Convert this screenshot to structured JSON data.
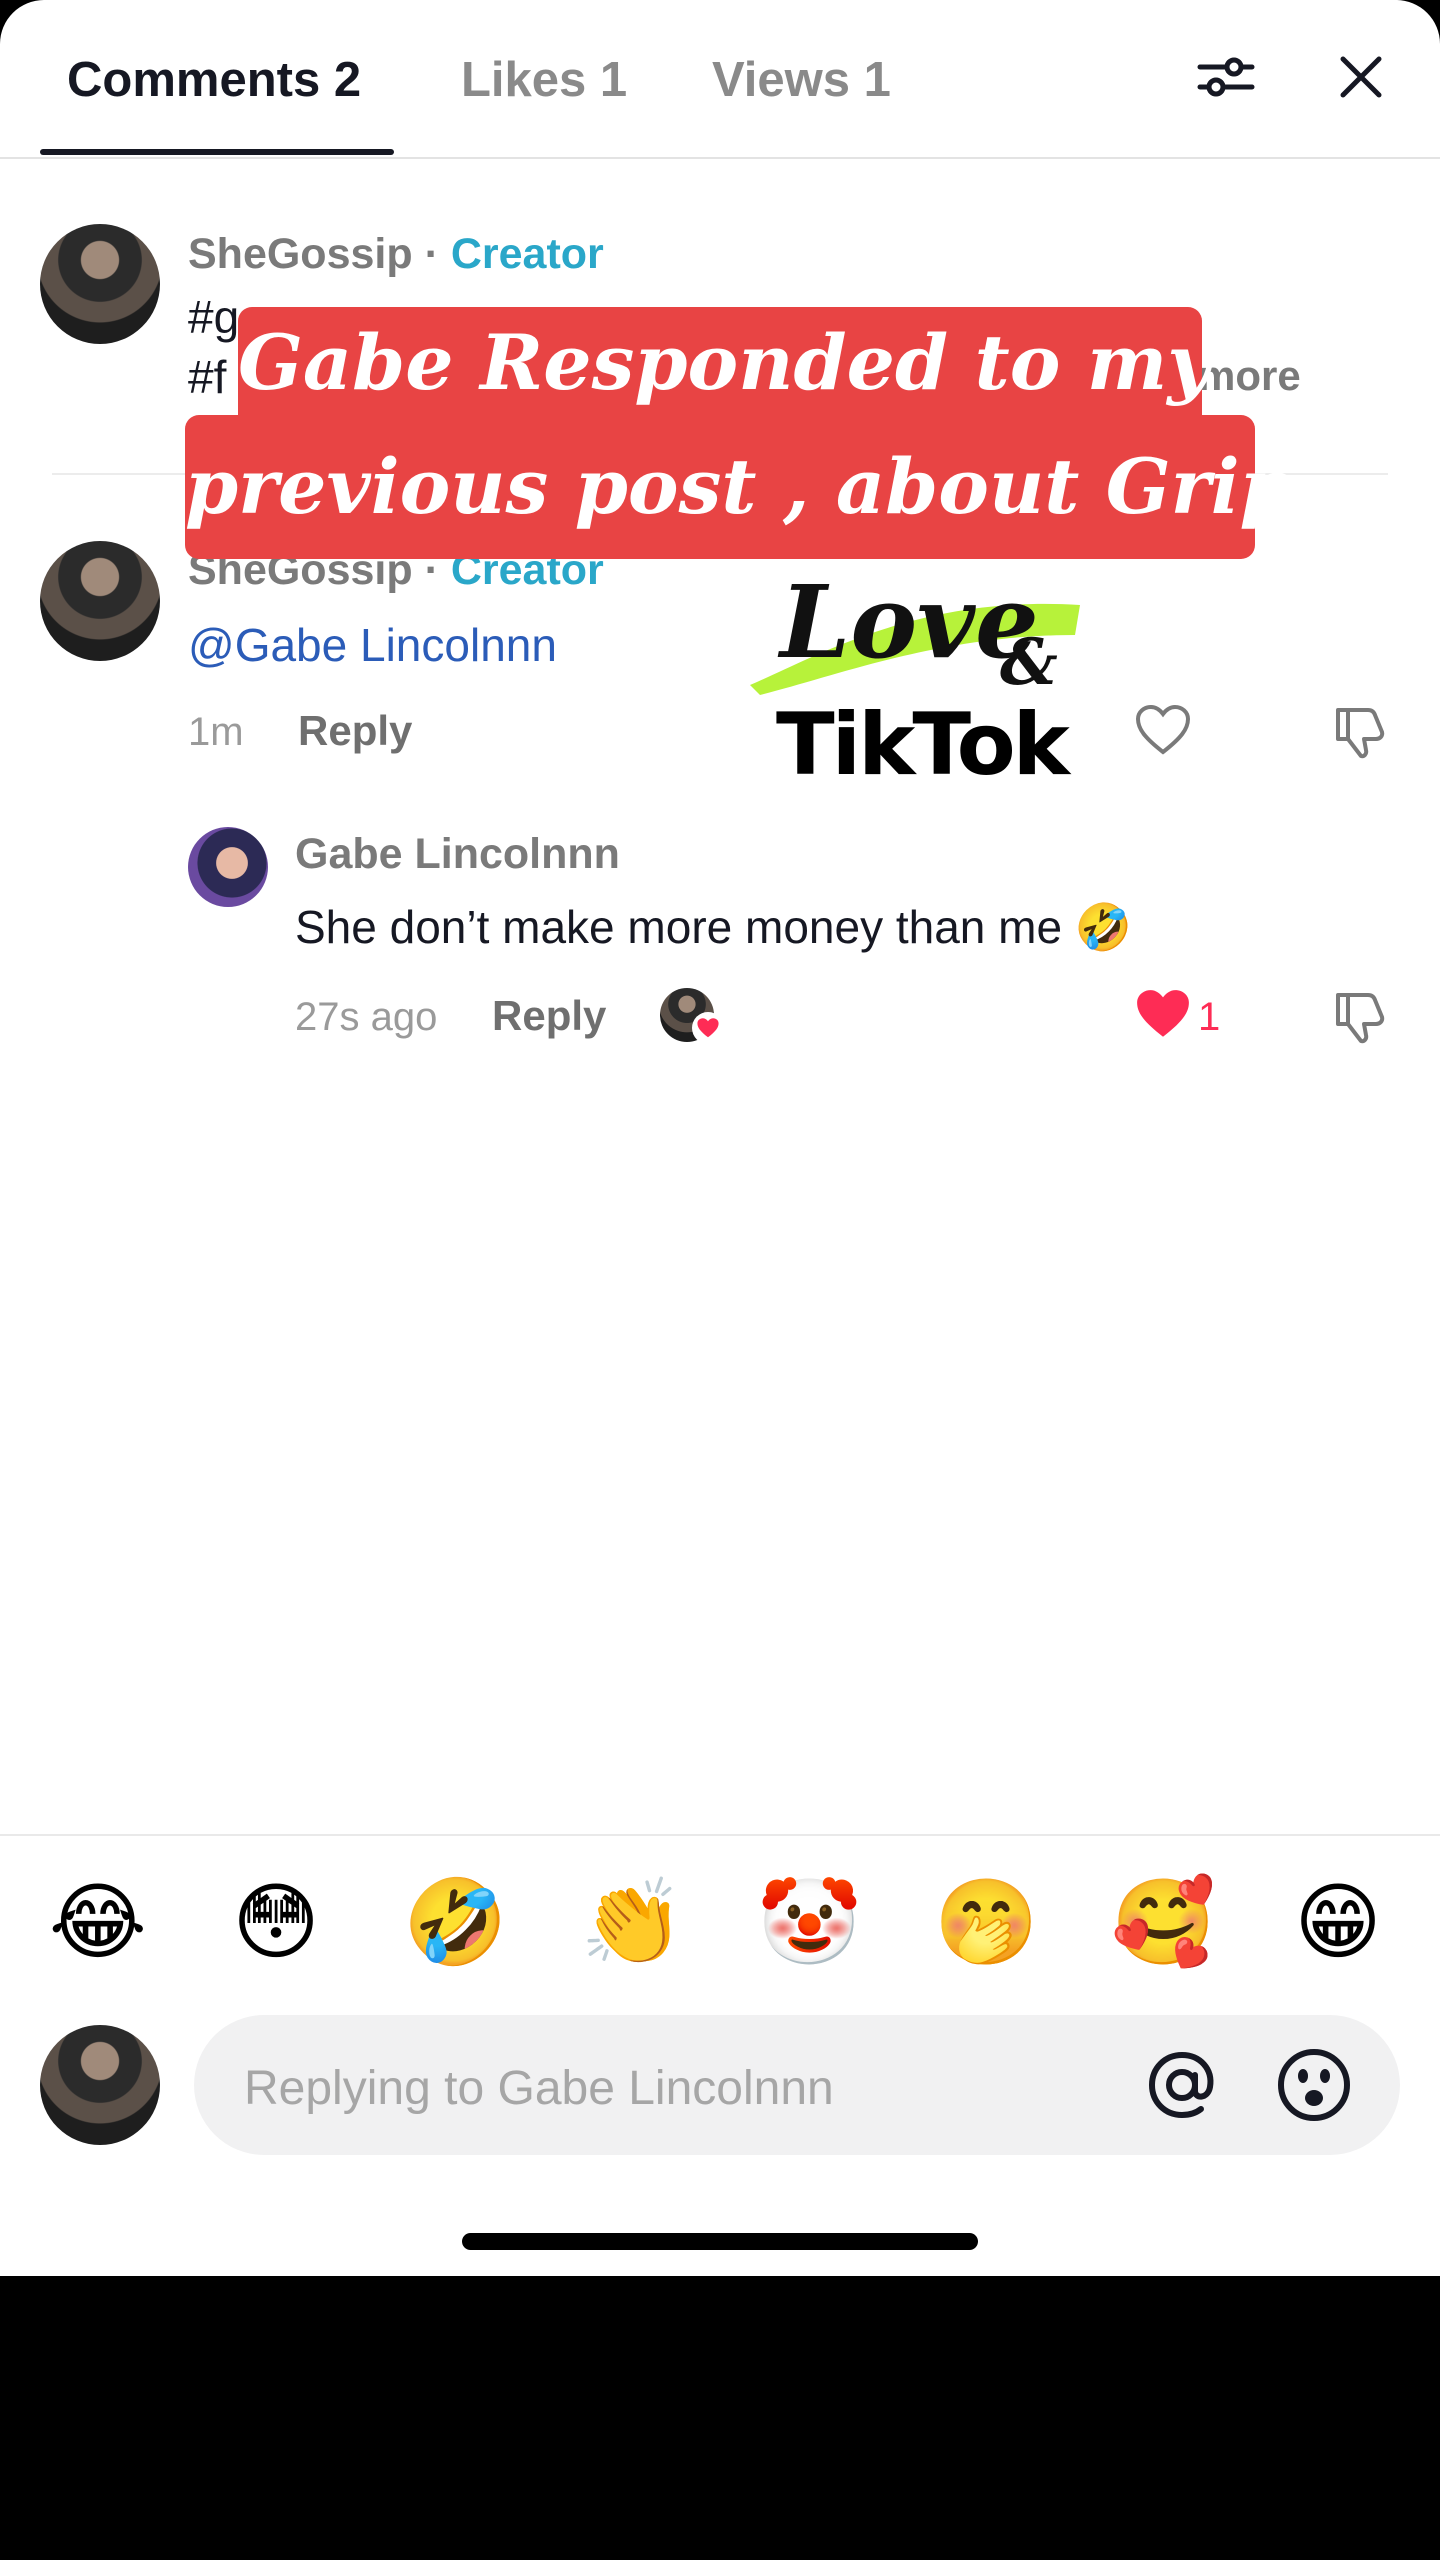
{
  "tabs": [
    {
      "label": "Comments 2",
      "active": true
    },
    {
      "label": "Likes 1",
      "active": false
    },
    {
      "label": "Views 1",
      "active": false
    }
  ],
  "header_icons": {
    "filter": "sliders-icon",
    "close": "close-icon"
  },
  "pinned_comment": {
    "username": "SheGossip",
    "separator": " · ",
    "badge": "Creator",
    "line1": "#g",
    "line2": "#f",
    "more_label": "more"
  },
  "comment": {
    "username": "SheGossip",
    "separator": " · ",
    "badge": "Creator",
    "text": "@Gabe Lincolnnn",
    "time": "1m",
    "reply_label": "Reply"
  },
  "reply_comment": {
    "username": "Gabe Lincolnnn",
    "text": "She don’t make more money than me 🤣",
    "time": "27s ago",
    "reply_label": "Reply",
    "like_count": "1"
  },
  "overlay": {
    "line1": "Gabe Responded to my",
    "line2": "previous post , about Grip",
    "logo_script": "Love",
    "logo_amp": "&",
    "logo_brand": "TikTok"
  },
  "emoji_bar": [
    "😂",
    "😳",
    "🤣",
    "👏",
    "🤡",
    "🤭",
    "🥰",
    "😁"
  ],
  "composer": {
    "placeholder": "Replying to Gabe Lincolnnn",
    "mention_icon": "at-icon",
    "emoji_icon": "emoji-icon"
  },
  "colors": {
    "accent": "#2aa7c9",
    "mention": "#2b5cb8",
    "banner": "#e84444",
    "like": "#fe2c55"
  }
}
